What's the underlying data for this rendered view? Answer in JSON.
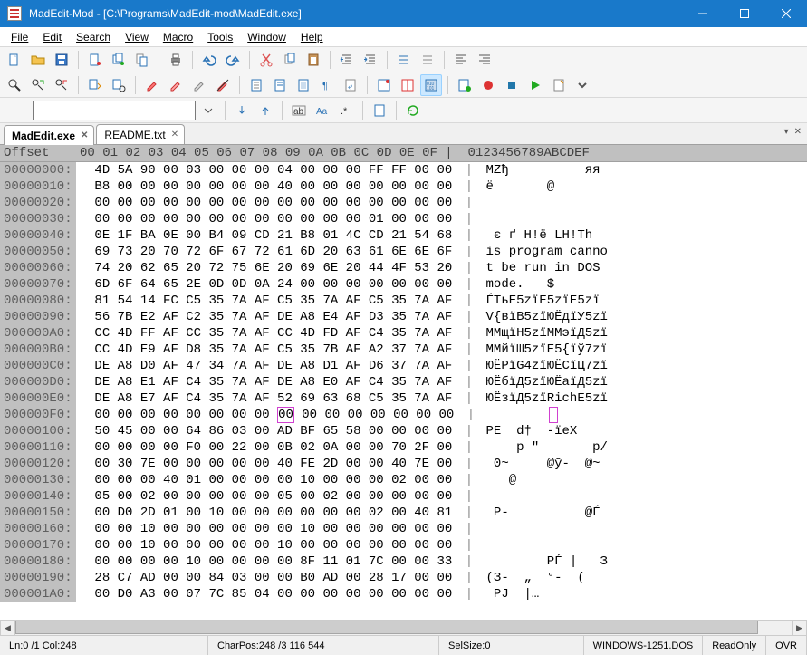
{
  "window": {
    "title": "MadEdit-Mod - [C:\\Programs\\MadEdit-mod\\MadEdit.exe]"
  },
  "menu": {
    "file": "File",
    "edit": "Edit",
    "search": "Search",
    "view": "View",
    "macro": "Macro",
    "tools": "Tools",
    "window": "Window",
    "help": "Help"
  },
  "tabs": [
    {
      "label": "MadEdit.exe",
      "active": true
    },
    {
      "label": "README.txt",
      "active": false
    }
  ],
  "hex": {
    "header_offset": "Offset  ",
    "header_cols": "00 01 02 03 04 05 06 07 08 09 0A 0B 0C 0D 0E 0F",
    "header_ascii": "0123456789ABCDEF",
    "selected": {
      "row": 15,
      "col": 8
    },
    "rows": [
      {
        "offset": "00000000:",
        "bytes": [
          "4D",
          "5A",
          "90",
          "00",
          "03",
          "00",
          "00",
          "00",
          "04",
          "00",
          "00",
          "00",
          "FF",
          "FF",
          "00",
          "00"
        ],
        "ascii": "MZђ          яя  "
      },
      {
        "offset": "00000010:",
        "bytes": [
          "B8",
          "00",
          "00",
          "00",
          "00",
          "00",
          "00",
          "00",
          "40",
          "00",
          "00",
          "00",
          "00",
          "00",
          "00",
          "00"
        ],
        "ascii": "ё       @       "
      },
      {
        "offset": "00000020:",
        "bytes": [
          "00",
          "00",
          "00",
          "00",
          "00",
          "00",
          "00",
          "00",
          "00",
          "00",
          "00",
          "00",
          "00",
          "00",
          "00",
          "00"
        ],
        "ascii": "                "
      },
      {
        "offset": "00000030:",
        "bytes": [
          "00",
          "00",
          "00",
          "00",
          "00",
          "00",
          "00",
          "00",
          "00",
          "00",
          "00",
          "00",
          "01",
          "00",
          "00",
          "00"
        ],
        "ascii": "               "
      },
      {
        "offset": "00000040:",
        "bytes": [
          "0E",
          "1F",
          "BA",
          "0E",
          "00",
          "B4",
          "09",
          "CD",
          "21",
          "B8",
          "01",
          "4C",
          "CD",
          "21",
          "54",
          "68"
        ],
        "ascii": " є ґ Н!ё LН!Th"
      },
      {
        "offset": "00000050:",
        "bytes": [
          "69",
          "73",
          "20",
          "70",
          "72",
          "6F",
          "67",
          "72",
          "61",
          "6D",
          "20",
          "63",
          "61",
          "6E",
          "6E",
          "6F"
        ],
        "ascii": "is program canno"
      },
      {
        "offset": "00000060:",
        "bytes": [
          "74",
          "20",
          "62",
          "65",
          "20",
          "72",
          "75",
          "6E",
          "20",
          "69",
          "6E",
          "20",
          "44",
          "4F",
          "53",
          "20"
        ],
        "ascii": "t be run in DOS "
      },
      {
        "offset": "00000070:",
        "bytes": [
          "6D",
          "6F",
          "64",
          "65",
          "2E",
          "0D",
          "0D",
          "0A",
          "24",
          "00",
          "00",
          "00",
          "00",
          "00",
          "00",
          "00"
        ],
        "ascii": "mode.   $       "
      },
      {
        "offset": "00000080:",
        "bytes": [
          "81",
          "54",
          "14",
          "FC",
          "C5",
          "35",
          "7A",
          "AF",
          "C5",
          "35",
          "7A",
          "AF",
          "C5",
          "35",
          "7A",
          "AF"
        ],
        "ascii": "ЃTьЕ5zїЕ5zїЕ5zї"
      },
      {
        "offset": "00000090:",
        "bytes": [
          "56",
          "7B",
          "E2",
          "AF",
          "C2",
          "35",
          "7A",
          "AF",
          "DE",
          "A8",
          "E4",
          "AF",
          "D3",
          "35",
          "7A",
          "AF"
        ],
        "ascii": "V{вїВ5zїЮЁдїУ5zї"
      },
      {
        "offset": "000000A0:",
        "bytes": [
          "CC",
          "4D",
          "FF",
          "AF",
          "CC",
          "35",
          "7A",
          "AF",
          "CC",
          "4D",
          "FD",
          "AF",
          "C4",
          "35",
          "7A",
          "AF"
        ],
        "ascii": "ММщїН5zїММэїД5zї"
      },
      {
        "offset": "000000B0:",
        "bytes": [
          "CC",
          "4D",
          "E9",
          "AF",
          "D8",
          "35",
          "7A",
          "AF",
          "C5",
          "35",
          "7B",
          "AF",
          "A2",
          "37",
          "7A",
          "AF"
        ],
        "ascii": "ММйїШ5zїЕ5{їў7zї"
      },
      {
        "offset": "000000C0:",
        "bytes": [
          "DE",
          "A8",
          "D0",
          "AF",
          "47",
          "34",
          "7A",
          "AF",
          "DE",
          "A8",
          "D1",
          "AF",
          "D6",
          "37",
          "7A",
          "AF"
        ],
        "ascii": "ЮЁРїG4zїЮЁСїЦ7zї"
      },
      {
        "offset": "000000D0:",
        "bytes": [
          "DE",
          "A8",
          "E1",
          "AF",
          "C4",
          "35",
          "7A",
          "AF",
          "DE",
          "A8",
          "E0",
          "AF",
          "C4",
          "35",
          "7A",
          "AF"
        ],
        "ascii": "ЮЁбїД5zїЮЁаїД5zї"
      },
      {
        "offset": "000000E0:",
        "bytes": [
          "DE",
          "A8",
          "E7",
          "AF",
          "C4",
          "35",
          "7A",
          "AF",
          "52",
          "69",
          "63",
          "68",
          "C5",
          "35",
          "7A",
          "AF"
        ],
        "ascii": "ЮЁзїД5zїRichЕ5zї"
      },
      {
        "offset": "000000F0:",
        "bytes": [
          "00",
          "00",
          "00",
          "00",
          "00",
          "00",
          "00",
          "00",
          "00",
          "00",
          "00",
          "00",
          "00",
          "00",
          "00",
          "00"
        ],
        "ascii": "                "
      },
      {
        "offset": "00000100:",
        "bytes": [
          "50",
          "45",
          "00",
          "00",
          "64",
          "86",
          "03",
          "00",
          "AD",
          "BF",
          "65",
          "58",
          "00",
          "00",
          "00",
          "00"
        ],
        "ascii": "PE  d†  -їeX    "
      },
      {
        "offset": "00000110:",
        "bytes": [
          "00",
          "00",
          "00",
          "00",
          "F0",
          "00",
          "22",
          "00",
          "0B",
          "02",
          "0A",
          "00",
          "00",
          "70",
          "2F",
          "00"
        ],
        "ascii": "    р \"       p/ "
      },
      {
        "offset": "00000120:",
        "bytes": [
          "00",
          "30",
          "7E",
          "00",
          "00",
          "00",
          "00",
          "00",
          "40",
          "FE",
          "2D",
          "00",
          "00",
          "40",
          "7E",
          "00"
        ],
        "ascii": " 0~     @ў-  @~ "
      },
      {
        "offset": "00000130:",
        "bytes": [
          "00",
          "00",
          "00",
          "40",
          "01",
          "00",
          "00",
          "00",
          "00",
          "10",
          "00",
          "00",
          "00",
          "02",
          "00",
          "00"
        ],
        "ascii": "   @           "
      },
      {
        "offset": "00000140:",
        "bytes": [
          "05",
          "00",
          "02",
          "00",
          "00",
          "00",
          "00",
          "00",
          "05",
          "00",
          "02",
          "00",
          "00",
          "00",
          "00",
          "00"
        ],
        "ascii": "              "
      },
      {
        "offset": "00000150:",
        "bytes": [
          "00",
          "D0",
          "2D",
          "01",
          "00",
          "10",
          "00",
          "00",
          "00",
          "00",
          "00",
          "00",
          "02",
          "00",
          "40",
          "81"
        ],
        "ascii": " Р-          @Ѓ"
      },
      {
        "offset": "00000160:",
        "bytes": [
          "00",
          "00",
          "10",
          "00",
          "00",
          "00",
          "00",
          "00",
          "00",
          "10",
          "00",
          "00",
          "00",
          "00",
          "00",
          "00"
        ],
        "ascii": "               "
      },
      {
        "offset": "00000170:",
        "bytes": [
          "00",
          "00",
          "10",
          "00",
          "00",
          "00",
          "00",
          "00",
          "10",
          "00",
          "00",
          "00",
          "00",
          "00",
          "00",
          "00"
        ],
        "ascii": "               "
      },
      {
        "offset": "00000180:",
        "bytes": [
          "00",
          "00",
          "00",
          "00",
          "10",
          "00",
          "00",
          "00",
          "00",
          "8F",
          "11",
          "01",
          "7C",
          "00",
          "00",
          "33"
        ],
        "ascii": "        РЃ |   З"
      },
      {
        "offset": "00000190:",
        "bytes": [
          "28",
          "C7",
          "AD",
          "00",
          "00",
          "84",
          "03",
          "00",
          "00",
          "B0",
          "AD",
          "00",
          "28",
          "17",
          "00",
          "00"
        ],
        "ascii": "(З-  „  °-  (    "
      },
      {
        "offset": "000001A0:",
        "bytes": [
          "00",
          "D0",
          "A3",
          "00",
          "07",
          "7C",
          "85",
          "04",
          "00",
          "00",
          "00",
          "00",
          "00",
          "00",
          "00",
          "00"
        ],
        "ascii": " РJ  |…        "
      }
    ]
  },
  "status": {
    "pos": "Ln:0 /1 Col:248",
    "charpos": "CharPos:248 /3 116 544",
    "selsize": "SelSize:0",
    "encoding": "WINDOWS-1251.DOS",
    "readonly": "ReadOnly",
    "ovr": "OVR"
  },
  "search": {
    "placeholder": ""
  }
}
